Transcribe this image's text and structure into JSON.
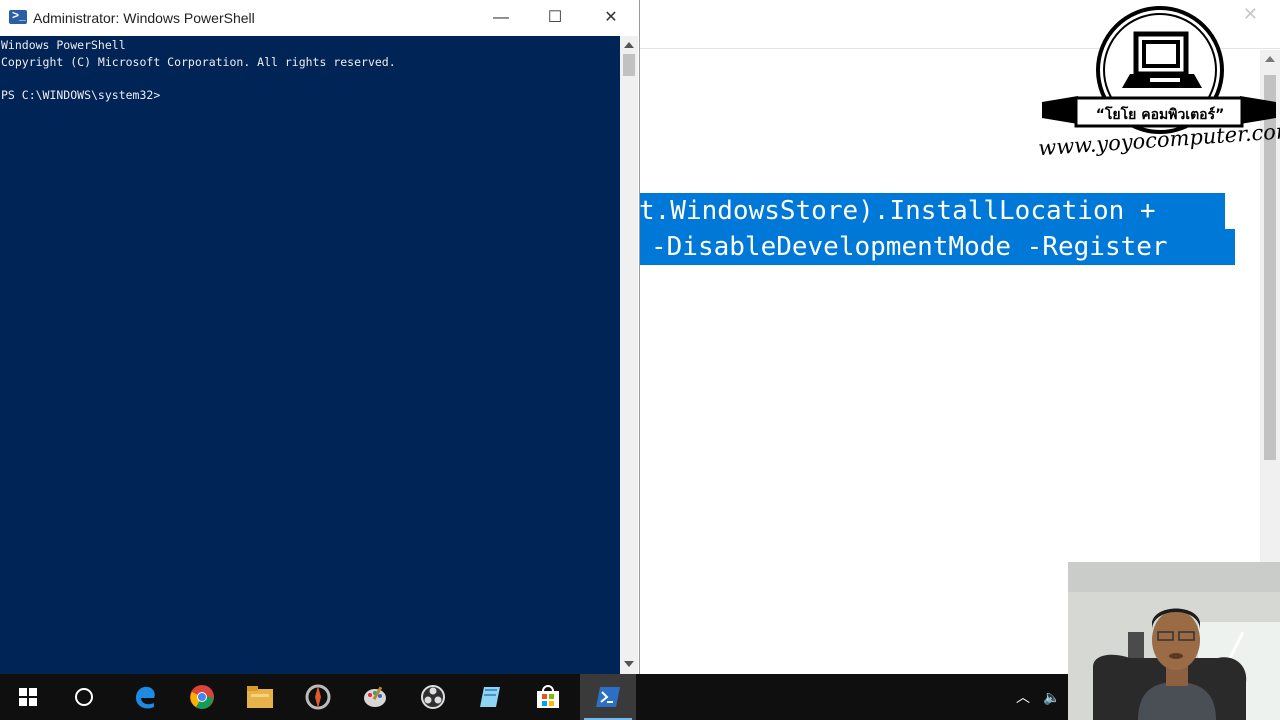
{
  "powershell": {
    "title": "Administrator: Windows PowerShell",
    "lines": [
      "Windows PowerShell",
      "Copyright (C) Microsoft Corporation. All rights reserved.",
      "PS C:\\WINDOWS\\system32>"
    ]
  },
  "background_doc": {
    "selected_lines": [
      "t.WindowsStore).InstallLocation +",
      "-DisableDevelopmentMode -Register"
    ]
  },
  "logo": {
    "name_th": "“โยโย คอมพิวเตอร์”",
    "url": "www.yoyocomputer.com"
  },
  "colors": {
    "console_bg": "#012456",
    "selection": "#0078d7",
    "taskbar": "#0f0f10"
  },
  "taskbar": {
    "icons": [
      "windows-start-icon",
      "cortana-icon",
      "edge-icon",
      "chrome-icon",
      "file-explorer-icon",
      "app-icon",
      "paint-icon",
      "obs-icon",
      "notepad-icon",
      "store-icon",
      "powershell-icon"
    ]
  }
}
